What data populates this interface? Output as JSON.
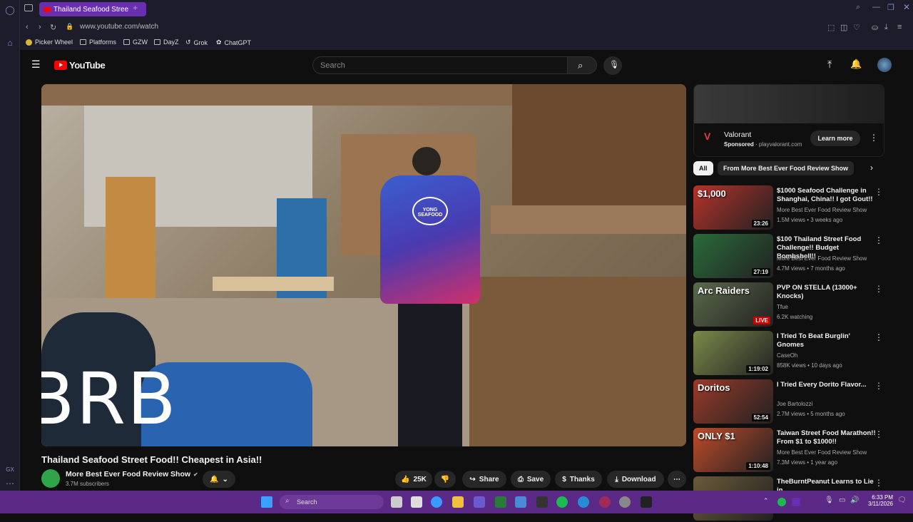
{
  "browser": {
    "tab_title": "Thailand Seafood Stree",
    "url": "www.youtube.com/watch",
    "bookmarks": [
      "Picker Wheel",
      "Platforms",
      "GZW",
      "DayZ",
      "Grok",
      "ChatGPT"
    ],
    "rail_label": "GX"
  },
  "youtube": {
    "logo": "YouTube",
    "search_placeholder": "Search",
    "video": {
      "overlay_text": "BRB",
      "shirt_text": "YONG SEAFOOD",
      "title": "Thailand Seafood Street Food!! Cheapest in Asia!!"
    },
    "channel": {
      "name": "More Best Ever Food Review Show",
      "subscribers": "3.7M subscribers"
    },
    "actions": {
      "likes": "25K",
      "share": "Share",
      "save": "Save",
      "thanks": "Thanks",
      "download": "Download"
    },
    "ad": {
      "advertiser": "Valorant",
      "sponsored": "Sponsored",
      "domain": "playvalorant.com",
      "cta": "Learn more"
    },
    "chips": [
      "All",
      "From More Best Ever Food Review Show"
    ],
    "recommendations": [
      {
        "title": "$1000 Seafood Challenge in Shanghai, China!! I got Gout!!",
        "channel": "More Best Ever Food Review Show",
        "meta": "1.5M views • 3 weeks ago",
        "duration": "23:26",
        "thumb_text": "$1,000",
        "color": "#b8322a"
      },
      {
        "title": "$100 Thailand Street Food Challenge!! Budget Bombshell!!",
        "channel": "More Best Ever Food Review Show",
        "meta": "4.7M views • 7 months ago",
        "duration": "27:19",
        "thumb_text": "",
        "color": "#2a6b3a"
      },
      {
        "title": "PVP ON STELLA (13000+ Knocks)",
        "channel": "Tfue",
        "meta": "6.2K watching",
        "duration": "LIVE",
        "thumb_text": "Arc Raiders",
        "color": "#5a6a4a"
      },
      {
        "title": "I Tried To Beat Burglin' Gnomes",
        "channel": "CaseOh",
        "meta": "858K views • 10 days ago",
        "duration": "1:19:02",
        "thumb_text": "",
        "color": "#7a8a4a"
      },
      {
        "title": "I Tried Every Dorito Flavor...",
        "channel": "Joe Bartolozzi",
        "meta": "2.7M views • 5 months ago",
        "duration": "52:54",
        "thumb_text": "Doritos",
        "color": "#9a3a2a"
      },
      {
        "title": "Taiwan Street Food Marathon!! From $1 to $1000!!",
        "channel": "More Best Ever Food Review Show",
        "meta": "7.3M views • 1 year ago",
        "duration": "1:10:48",
        "thumb_text": "ONLY $1",
        "color": "#c04a2a"
      },
      {
        "title": "TheBurntPeanut Learns to Lie in",
        "channel": "",
        "meta": "",
        "duration": "",
        "thumb_text": "",
        "color": "#6a5a3a"
      }
    ]
  },
  "taskbar": {
    "search": "Search",
    "time": "6:33 PM",
    "date": "3/11/2026"
  }
}
